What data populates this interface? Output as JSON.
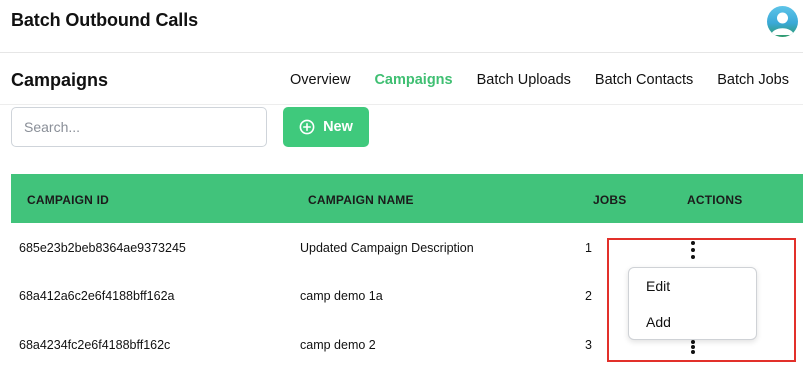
{
  "header": {
    "app_title": "Batch Outbound Calls"
  },
  "page": {
    "title": "Campaigns"
  },
  "tabs": [
    {
      "label": "Overview",
      "active": false
    },
    {
      "label": "Campaigns",
      "active": true
    },
    {
      "label": "Batch Uploads",
      "active": false
    },
    {
      "label": "Batch Contacts",
      "active": false
    },
    {
      "label": "Batch Jobs",
      "active": false
    }
  ],
  "toolbar": {
    "search_placeholder": "Search...",
    "search_value": "",
    "new_label": "New"
  },
  "table": {
    "columns": [
      "CAMPAIGN ID",
      "CAMPAIGN NAME",
      "JOBS",
      "ACTIONS"
    ],
    "rows": [
      {
        "id": "685e23b2beb8364ae9373245",
        "name": "Updated Campaign Description",
        "jobs": "1"
      },
      {
        "id": "68a412a6c2e6f4188bff162a",
        "name": "camp demo 1a",
        "jobs": "2"
      },
      {
        "id": "68a4234fc2e6f4188bff162c",
        "name": "camp demo 2",
        "jobs": "3"
      }
    ]
  },
  "action_menu": {
    "items": [
      "Edit",
      "Add"
    ]
  },
  "colors": {
    "accent": "#41c37b",
    "button": "#3fc97c",
    "active_tab": "#3fbf72",
    "highlight_border": "#e2302a"
  },
  "icons": {
    "avatar": "user-avatar-icon",
    "new_button": "plus-circle-icon",
    "row_actions": "kebab-menu-icon"
  }
}
